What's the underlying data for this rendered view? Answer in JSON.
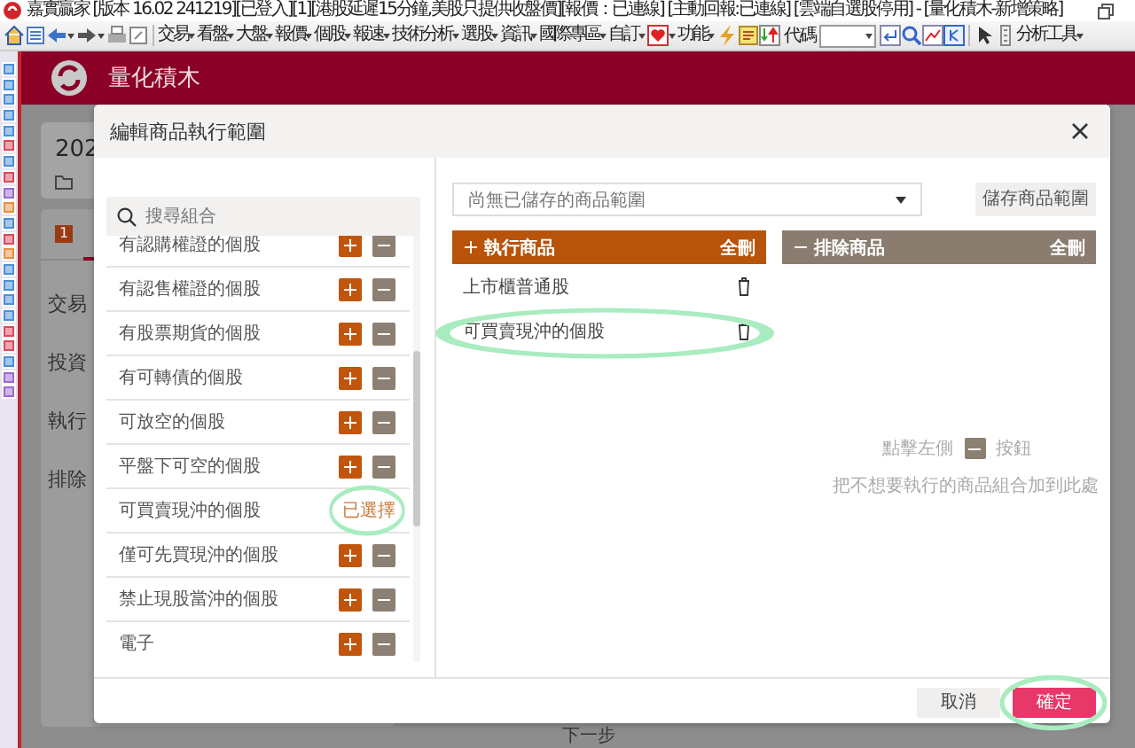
{
  "window": {
    "title": "嘉實贏家 [版本 16.02 241219][已登入][1][港股延遲15分鐘,美股只提供收盤價][報價：已連線] [主動回報:已連線] [雲端自選股停用] - [量化積木-新增策略]"
  },
  "toolbar": {
    "menus": [
      "交易",
      "看盤",
      "大盤",
      "報價",
      "個股",
      "報速",
      "技術分析",
      "選股",
      "資訊",
      "國際專區",
      "自訂",
      "功能"
    ],
    "code_label": "代碼",
    "tools_menu": "分析工具"
  },
  "app_header": {
    "title": "量化積木"
  },
  "background": {
    "card_title": "202",
    "tab_badge": "1",
    "labels": [
      "交易",
      "投資",
      "執行",
      "排除"
    ],
    "next_button": "下一步"
  },
  "dialog": {
    "title": "編輯商品執行範圍",
    "left_list": {
      "search_placeholder": "搜尋組合",
      "selected_label": "已選擇",
      "items": [
        {
          "label": "有認購權證的個股",
          "selected": false,
          "circled": false
        },
        {
          "label": "有認售權證的個股",
          "selected": false,
          "circled": false
        },
        {
          "label": "有股票期貨的個股",
          "selected": false,
          "circled": false
        },
        {
          "label": "有可轉債的個股",
          "selected": false,
          "circled": false
        },
        {
          "label": "可放空的個股",
          "selected": false,
          "circled": false
        },
        {
          "label": "平盤下可空的個股",
          "selected": false,
          "circled": false
        },
        {
          "label": "可買賣現沖的個股",
          "selected": true,
          "circled": true
        },
        {
          "label": "僅可先買現沖的個股",
          "selected": false,
          "circled": false
        },
        {
          "label": "禁止現股當沖的個股",
          "selected": false,
          "circled": false
        },
        {
          "label": "電子",
          "selected": false,
          "circled": false
        }
      ]
    },
    "range_dropdown": {
      "value": "尚無已儲存的商品範圍"
    },
    "save_button": "儲存商品範圍",
    "include_column": {
      "title": "執行商品",
      "clear_label": "全刪",
      "items": [
        {
          "label": "上市櫃普通股",
          "circled": false
        },
        {
          "label": "可買賣現沖的個股",
          "circled": true
        }
      ]
    },
    "exclude_column": {
      "title": "排除商品",
      "clear_label": "全刪",
      "hint_before": "點擊左側",
      "hint_after": "按鈕",
      "hint_line2": "把不想要執行的商品組合加到此處"
    },
    "buttons": [
      {
        "label": "取消",
        "kind": "secondary",
        "circled": false
      },
      {
        "label": "確定",
        "kind": "primary",
        "circled": true
      }
    ]
  }
}
